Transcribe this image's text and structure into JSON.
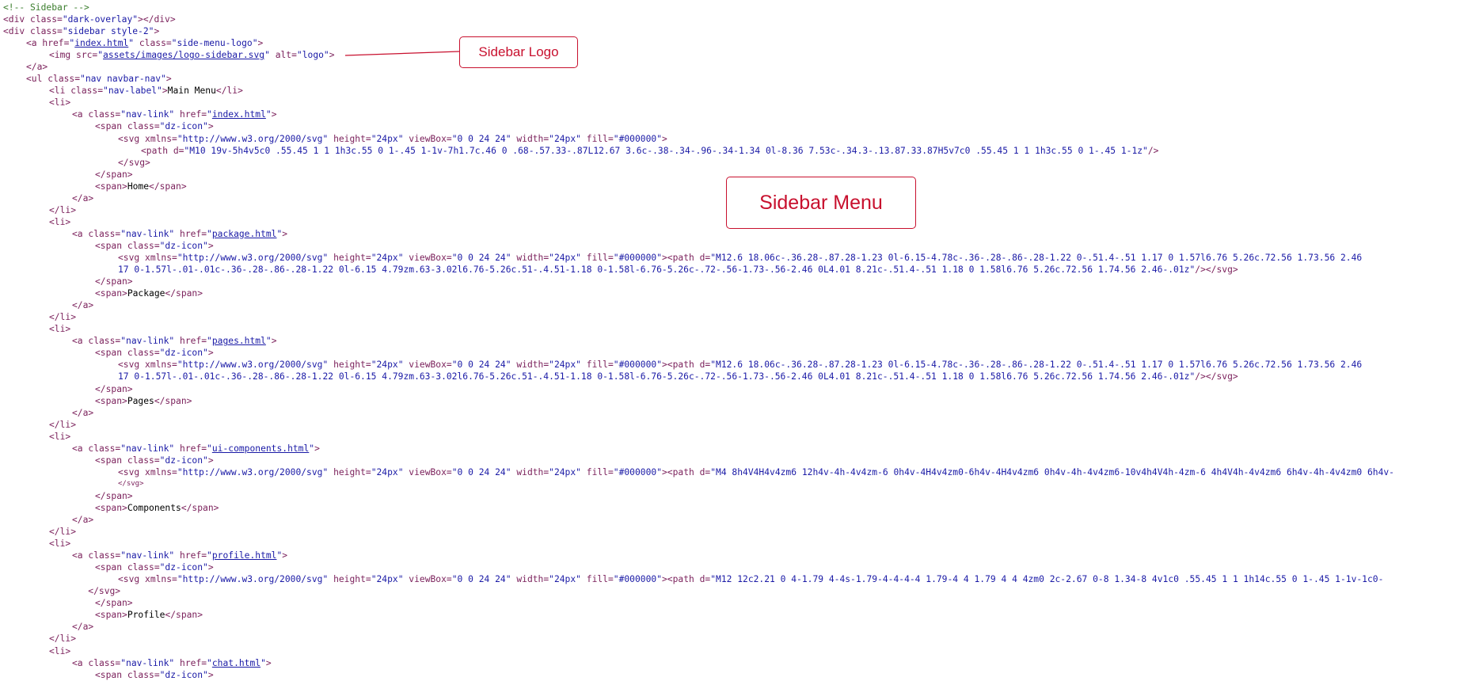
{
  "code_lines": [
    {
      "indent": 0,
      "parts": [
        {
          "t": "c",
          "v": "<!-- Sidebar -->"
        }
      ]
    },
    {
      "indent": 0,
      "parts": [
        {
          "t": "g",
          "v": "<div "
        },
        {
          "t": "a",
          "v": "class="
        },
        {
          "t": "s",
          "v": "\"dark-overlay\""
        },
        {
          "t": "g",
          "v": "></div>"
        }
      ]
    },
    {
      "indent": 0,
      "parts": [
        {
          "t": "g",
          "v": "<div "
        },
        {
          "t": "a",
          "v": "class="
        },
        {
          "t": "s",
          "v": "\"sidebar style-2\""
        },
        {
          "t": "g",
          "v": ">"
        }
      ]
    },
    {
      "indent": 1,
      "parts": [
        {
          "t": "g",
          "v": "<a "
        },
        {
          "t": "a",
          "v": "href="
        },
        {
          "t": "s",
          "v": "\""
        },
        {
          "t": "l",
          "v": "index.html"
        },
        {
          "t": "s",
          "v": "\""
        },
        {
          "t": "a",
          "v": " class="
        },
        {
          "t": "s",
          "v": "\"side-menu-logo\""
        },
        {
          "t": "g",
          "v": ">"
        }
      ]
    },
    {
      "indent": 2,
      "parts": [
        {
          "t": "g",
          "v": "<img "
        },
        {
          "t": "a",
          "v": "src="
        },
        {
          "t": "s",
          "v": "\""
        },
        {
          "t": "l",
          "v": "assets/images/logo-sidebar.svg"
        },
        {
          "t": "s",
          "v": "\""
        },
        {
          "t": "a",
          "v": " alt="
        },
        {
          "t": "s",
          "v": "\"logo\""
        },
        {
          "t": "g",
          "v": ">"
        }
      ]
    },
    {
      "indent": 1,
      "parts": [
        {
          "t": "g",
          "v": "</a>"
        }
      ]
    },
    {
      "indent": 1,
      "parts": [
        {
          "t": "g",
          "v": "<ul "
        },
        {
          "t": "a",
          "v": "class="
        },
        {
          "t": "s",
          "v": "\"nav navbar-nav\""
        },
        {
          "t": "g",
          "v": ">"
        }
      ]
    },
    {
      "indent": 2,
      "parts": [
        {
          "t": "g",
          "v": "<li "
        },
        {
          "t": "a",
          "v": "class="
        },
        {
          "t": "s",
          "v": "\"nav-label\""
        },
        {
          "t": "g",
          "v": ">"
        },
        {
          "t": "x",
          "v": "Main Menu"
        },
        {
          "t": "g",
          "v": "</li>"
        }
      ]
    },
    {
      "indent": 2,
      "parts": [
        {
          "t": "g",
          "v": "<li>"
        }
      ]
    },
    {
      "indent": 3,
      "parts": [
        {
          "t": "g",
          "v": "<a "
        },
        {
          "t": "a",
          "v": "class="
        },
        {
          "t": "s",
          "v": "\"nav-link\""
        },
        {
          "t": "a",
          "v": " href="
        },
        {
          "t": "s",
          "v": "\""
        },
        {
          "t": "l",
          "v": "index.html"
        },
        {
          "t": "s",
          "v": "\""
        },
        {
          "t": "g",
          "v": ">"
        }
      ]
    },
    {
      "indent": 4,
      "parts": [
        {
          "t": "g",
          "v": "<span "
        },
        {
          "t": "a",
          "v": "class="
        },
        {
          "t": "s",
          "v": "\"dz-icon\""
        },
        {
          "t": "g",
          "v": ">"
        }
      ]
    },
    {
      "indent": 5,
      "parts": [
        {
          "t": "g",
          "v": "<svg "
        },
        {
          "t": "a",
          "v": "xmlns="
        },
        {
          "t": "s",
          "v": "\"http://www.w3.org/2000/svg\""
        },
        {
          "t": "a",
          "v": " height="
        },
        {
          "t": "s",
          "v": "\"24px\""
        },
        {
          "t": "a",
          "v": " viewBox="
        },
        {
          "t": "s",
          "v": "\"0 0 24 24\""
        },
        {
          "t": "a",
          "v": " width="
        },
        {
          "t": "s",
          "v": "\"24px\""
        },
        {
          "t": "a",
          "v": " fill="
        },
        {
          "t": "s",
          "v": "\"#000000\""
        },
        {
          "t": "g",
          "v": ">"
        }
      ]
    },
    {
      "indent": 6,
      "parts": [
        {
          "t": "g",
          "v": "<path "
        },
        {
          "t": "a",
          "v": "d="
        },
        {
          "t": "s",
          "v": "\"M10 19v-5h4v5c0 .55.45 1 1 1h3c.55 0 1-.45 1-1v-7h1.7c.46 0 .68-.57.33-.87L12.67 3.6c-.38-.34-.96-.34-1.34 0l-8.36 7.53c-.34.3-.13.87.33.87H5v7c0 .55.45 1 1 1h3c.55 0 1-.45 1-1z\""
        },
        {
          "t": "g",
          "v": "/>"
        }
      ]
    },
    {
      "indent": 5,
      "parts": [
        {
          "t": "g",
          "v": "</svg>"
        }
      ]
    },
    {
      "indent": 4,
      "parts": [
        {
          "t": "g",
          "v": "</span>"
        }
      ]
    },
    {
      "indent": 4,
      "parts": [
        {
          "t": "g",
          "v": "<span>"
        },
        {
          "t": "x",
          "v": "Home"
        },
        {
          "t": "g",
          "v": "</span>"
        }
      ]
    },
    {
      "indent": 3,
      "parts": [
        {
          "t": "g",
          "v": "</a>"
        }
      ]
    },
    {
      "indent": 2,
      "parts": [
        {
          "t": "g",
          "v": "</li>"
        }
      ]
    },
    {
      "indent": 2,
      "parts": [
        {
          "t": "g",
          "v": "<li>"
        }
      ]
    },
    {
      "indent": 3,
      "parts": [
        {
          "t": "g",
          "v": "<a "
        },
        {
          "t": "a",
          "v": "class="
        },
        {
          "t": "s",
          "v": "\"nav-link\""
        },
        {
          "t": "a",
          "v": " href="
        },
        {
          "t": "s",
          "v": "\""
        },
        {
          "t": "l",
          "v": "package.html"
        },
        {
          "t": "s",
          "v": "\""
        },
        {
          "t": "g",
          "v": ">"
        }
      ]
    },
    {
      "indent": 4,
      "parts": [
        {
          "t": "g",
          "v": "<span "
        },
        {
          "t": "a",
          "v": "class="
        },
        {
          "t": "s",
          "v": "\"dz-icon\""
        },
        {
          "t": "g",
          "v": ">"
        }
      ]
    },
    {
      "indent": 5,
      "parts": [
        {
          "t": "g",
          "v": "<svg "
        },
        {
          "t": "a",
          "v": "xmlns="
        },
        {
          "t": "s",
          "v": "\"http://www.w3.org/2000/svg\""
        },
        {
          "t": "a",
          "v": " height="
        },
        {
          "t": "s",
          "v": "\"24px\""
        },
        {
          "t": "a",
          "v": " viewBox="
        },
        {
          "t": "s",
          "v": "\"0 0 24 24\""
        },
        {
          "t": "a",
          "v": " width="
        },
        {
          "t": "s",
          "v": "\"24px\""
        },
        {
          "t": "a",
          "v": " fill="
        },
        {
          "t": "s",
          "v": "\"#000000\""
        },
        {
          "t": "g",
          "v": "><path "
        },
        {
          "t": "a",
          "v": "d="
        },
        {
          "t": "s",
          "v": "\"M12.6 18.06c-.36.28-.87.28-1.23 0l-6.15-4.78c-.36-.28-.86-.28-1.22 0-.51.4-.51 1.17 0 1.57l6.76 5.26c.72.56 1.73.56 2.46"
        }
      ]
    },
    {
      "indent": 5,
      "parts": [
        {
          "t": "s",
          "v": "17 0-1.57l-.01-.01c-.36-.28-.86-.28-1.22 0l-6.15 4.79zm.63-3.02l6.76-5.26c.51-.4.51-1.18 0-1.58l-6.76-5.26c-.72-.56-1.73-.56-2.46 0L4.01 8.21c-.51.4-.51 1.18 0 1.58l6.76 5.26c.72.56 1.74.56 2.46-.01z\""
        },
        {
          "t": "g",
          "v": "/></svg>"
        }
      ]
    },
    {
      "indent": 4,
      "parts": [
        {
          "t": "g",
          "v": "</span>"
        }
      ]
    },
    {
      "indent": 4,
      "parts": [
        {
          "t": "g",
          "v": "<span>"
        },
        {
          "t": "x",
          "v": "Package"
        },
        {
          "t": "g",
          "v": "</span>"
        }
      ]
    },
    {
      "indent": 3,
      "parts": [
        {
          "t": "g",
          "v": "</a>"
        }
      ]
    },
    {
      "indent": 2,
      "parts": [
        {
          "t": "g",
          "v": "</li>"
        }
      ]
    },
    {
      "indent": 2,
      "parts": [
        {
          "t": "g",
          "v": "<li>"
        }
      ]
    },
    {
      "indent": 3,
      "parts": [
        {
          "t": "g",
          "v": "<a "
        },
        {
          "t": "a",
          "v": "class="
        },
        {
          "t": "s",
          "v": "\"nav-link\""
        },
        {
          "t": "a",
          "v": " href="
        },
        {
          "t": "s",
          "v": "\""
        },
        {
          "t": "l",
          "v": "pages.html"
        },
        {
          "t": "s",
          "v": "\""
        },
        {
          "t": "g",
          "v": ">"
        }
      ]
    },
    {
      "indent": 4,
      "parts": [
        {
          "t": "g",
          "v": "<span "
        },
        {
          "t": "a",
          "v": "class="
        },
        {
          "t": "s",
          "v": "\"dz-icon\""
        },
        {
          "t": "g",
          "v": ">"
        }
      ]
    },
    {
      "indent": 5,
      "parts": [
        {
          "t": "g",
          "v": "<svg "
        },
        {
          "t": "a",
          "v": "xmlns="
        },
        {
          "t": "s",
          "v": "\"http://www.w3.org/2000/svg\""
        },
        {
          "t": "a",
          "v": " height="
        },
        {
          "t": "s",
          "v": "\"24px\""
        },
        {
          "t": "a",
          "v": " viewBox="
        },
        {
          "t": "s",
          "v": "\"0 0 24 24\""
        },
        {
          "t": "a",
          "v": " width="
        },
        {
          "t": "s",
          "v": "\"24px\""
        },
        {
          "t": "a",
          "v": " fill="
        },
        {
          "t": "s",
          "v": "\"#000000\""
        },
        {
          "t": "g",
          "v": "><path "
        },
        {
          "t": "a",
          "v": "d="
        },
        {
          "t": "s",
          "v": "\"M12.6 18.06c-.36.28-.87.28-1.23 0l-6.15-4.78c-.36-.28-.86-.28-1.22 0-.51.4-.51 1.17 0 1.57l6.76 5.26c.72.56 1.73.56 2.46"
        }
      ]
    },
    {
      "indent": 5,
      "parts": [
        {
          "t": "s",
          "v": "17 0-1.57l-.01-.01c-.36-.28-.86-.28-1.22 0l-6.15 4.79zm.63-3.02l6.76-5.26c.51-.4.51-1.18 0-1.58l-6.76-5.26c-.72-.56-1.73-.56-2.46 0L4.01 8.21c-.51.4-.51 1.18 0 1.58l6.76 5.26c.72.56 1.74.56 2.46-.01z\""
        },
        {
          "t": "g",
          "v": "/></svg>"
        }
      ]
    },
    {
      "indent": 4,
      "parts": [
        {
          "t": "g",
          "v": "</span>"
        }
      ]
    },
    {
      "indent": 4,
      "parts": [
        {
          "t": "g",
          "v": "<span>"
        },
        {
          "t": "x",
          "v": "Pages"
        },
        {
          "t": "g",
          "v": "</span>"
        }
      ]
    },
    {
      "indent": 3,
      "parts": [
        {
          "t": "g",
          "v": "</a>"
        }
      ]
    },
    {
      "indent": 2,
      "parts": [
        {
          "t": "g",
          "v": "</li>"
        }
      ]
    },
    {
      "indent": 2,
      "parts": [
        {
          "t": "g",
          "v": "<li>"
        }
      ]
    },
    {
      "indent": 3,
      "parts": [
        {
          "t": "g",
          "v": "<a "
        },
        {
          "t": "a",
          "v": "class="
        },
        {
          "t": "s",
          "v": "\"nav-link\""
        },
        {
          "t": "a",
          "v": " href="
        },
        {
          "t": "s",
          "v": "\""
        },
        {
          "t": "l",
          "v": "ui-components.html"
        },
        {
          "t": "s",
          "v": "\""
        },
        {
          "t": "g",
          "v": ">"
        }
      ]
    },
    {
      "indent": 4,
      "parts": [
        {
          "t": "g",
          "v": "<span "
        },
        {
          "t": "a",
          "v": "class="
        },
        {
          "t": "s",
          "v": "\"dz-icon\""
        },
        {
          "t": "g",
          "v": ">"
        }
      ]
    },
    {
      "indent": 5,
      "parts": [
        {
          "t": "g",
          "v": "<svg "
        },
        {
          "t": "a",
          "v": "xmlns="
        },
        {
          "t": "s",
          "v": "\"http://www.w3.org/2000/svg\""
        },
        {
          "t": "a",
          "v": " height="
        },
        {
          "t": "s",
          "v": "\"24px\""
        },
        {
          "t": "a",
          "v": " viewBox="
        },
        {
          "t": "s",
          "v": "\"0 0 24 24\""
        },
        {
          "t": "a",
          "v": " width="
        },
        {
          "t": "s",
          "v": "\"24px\""
        },
        {
          "t": "a",
          "v": " fill="
        },
        {
          "t": "s",
          "v": "\"#000000\""
        },
        {
          "t": "g",
          "v": "><path "
        },
        {
          "t": "a",
          "v": "d="
        },
        {
          "t": "s",
          "v": "\"M4 8h4V4H4v4zm6 12h4v-4h-4v4zm-6 0h4v-4H4v4zm0-6h4v-4H4v4zm6 0h4v-4h-4v4zm6-10v4h4V4h-4zm-6 4h4V4h-4v4zm6 6h4v-4h-4v4zm0 6h4v-"
        }
      ]
    },
    {
      "indent": 5,
      "small": true,
      "parts": [
        {
          "t": "g",
          "v": "</svg>"
        }
      ]
    },
    {
      "indent": 4,
      "parts": [
        {
          "t": "g",
          "v": "</span>"
        }
      ]
    },
    {
      "indent": 4,
      "parts": [
        {
          "t": "g",
          "v": "<span>"
        },
        {
          "t": "x",
          "v": "Components"
        },
        {
          "t": "g",
          "v": "</span>"
        }
      ]
    },
    {
      "indent": 3,
      "parts": [
        {
          "t": "g",
          "v": "</a>"
        }
      ]
    },
    {
      "indent": 2,
      "parts": [
        {
          "t": "g",
          "v": "</li>"
        }
      ]
    },
    {
      "indent": 2,
      "parts": [
        {
          "t": "g",
          "v": "<li>"
        }
      ]
    },
    {
      "indent": 3,
      "parts": [
        {
          "t": "g",
          "v": "<a "
        },
        {
          "t": "a",
          "v": "class="
        },
        {
          "t": "s",
          "v": "\"nav-link\""
        },
        {
          "t": "a",
          "v": " href="
        },
        {
          "t": "s",
          "v": "\""
        },
        {
          "t": "l",
          "v": "profile.html"
        },
        {
          "t": "s",
          "v": "\""
        },
        {
          "t": "g",
          "v": ">"
        }
      ]
    },
    {
      "indent": 4,
      "parts": [
        {
          "t": "g",
          "v": "<span "
        },
        {
          "t": "a",
          "v": "class="
        },
        {
          "t": "s",
          "v": "\"dz-icon\""
        },
        {
          "t": "g",
          "v": ">"
        }
      ]
    },
    {
      "indent": 5,
      "parts": [
        {
          "t": "g",
          "v": "<svg "
        },
        {
          "t": "a",
          "v": "xmlns="
        },
        {
          "t": "s",
          "v": "\"http://www.w3.org/2000/svg\""
        },
        {
          "t": "a",
          "v": " height="
        },
        {
          "t": "s",
          "v": "\"24px\""
        },
        {
          "t": "a",
          "v": " viewBox="
        },
        {
          "t": "s",
          "v": "\"0 0 24 24\""
        },
        {
          "t": "a",
          "v": " width="
        },
        {
          "t": "s",
          "v": "\"24px\""
        },
        {
          "t": "a",
          "v": " fill="
        },
        {
          "t": "s",
          "v": "\"#000000\""
        },
        {
          "t": "g",
          "v": "><path "
        },
        {
          "t": "a",
          "v": "d="
        },
        {
          "t": "s",
          "v": "\"M12 12c2.21 0 4-1.79 4-4s-1.79-4-4-4-4 1.79-4 4 1.79 4 4 4zm0 2c-2.67 0-8 1.34-8 4v1c0 .55.45 1 1 1h14c.55 0 1-.45 1-1v-1c0-"
        }
      ]
    },
    {
      "indent": 3.7,
      "parts": [
        {
          "t": "g",
          "v": "</svg>"
        }
      ]
    },
    {
      "indent": 4,
      "parts": [
        {
          "t": "g",
          "v": "</span>"
        }
      ]
    },
    {
      "indent": 4,
      "parts": [
        {
          "t": "g",
          "v": "<span>"
        },
        {
          "t": "x",
          "v": "Profile"
        },
        {
          "t": "g",
          "v": "</span>"
        }
      ]
    },
    {
      "indent": 3,
      "parts": [
        {
          "t": "g",
          "v": "</a>"
        }
      ]
    },
    {
      "indent": 2,
      "parts": [
        {
          "t": "g",
          "v": "</li>"
        }
      ]
    },
    {
      "indent": 2,
      "parts": [
        {
          "t": "g",
          "v": "<li>"
        }
      ]
    },
    {
      "indent": 3,
      "parts": [
        {
          "t": "g",
          "v": "<a "
        },
        {
          "t": "a",
          "v": "class="
        },
        {
          "t": "s",
          "v": "\"nav-link\""
        },
        {
          "t": "a",
          "v": " href="
        },
        {
          "t": "s",
          "v": "\""
        },
        {
          "t": "l",
          "v": "chat.html"
        },
        {
          "t": "s",
          "v": "\""
        },
        {
          "t": "g",
          "v": ">"
        }
      ]
    },
    {
      "indent": 4,
      "parts": [
        {
          "t": "g",
          "v": "<span "
        },
        {
          "t": "a",
          "v": "class="
        },
        {
          "t": "s",
          "v": "\"dz-icon\""
        },
        {
          "t": "g",
          "v": ">"
        }
      ]
    }
  ],
  "annotations": {
    "logo_label": "Sidebar Logo",
    "menu_label": "Sidebar Menu"
  },
  "colors": {
    "annotation": "#c8102e",
    "comment": "#3a7d2c",
    "tag": "#7a1f5a",
    "string": "#1a1aa6"
  }
}
